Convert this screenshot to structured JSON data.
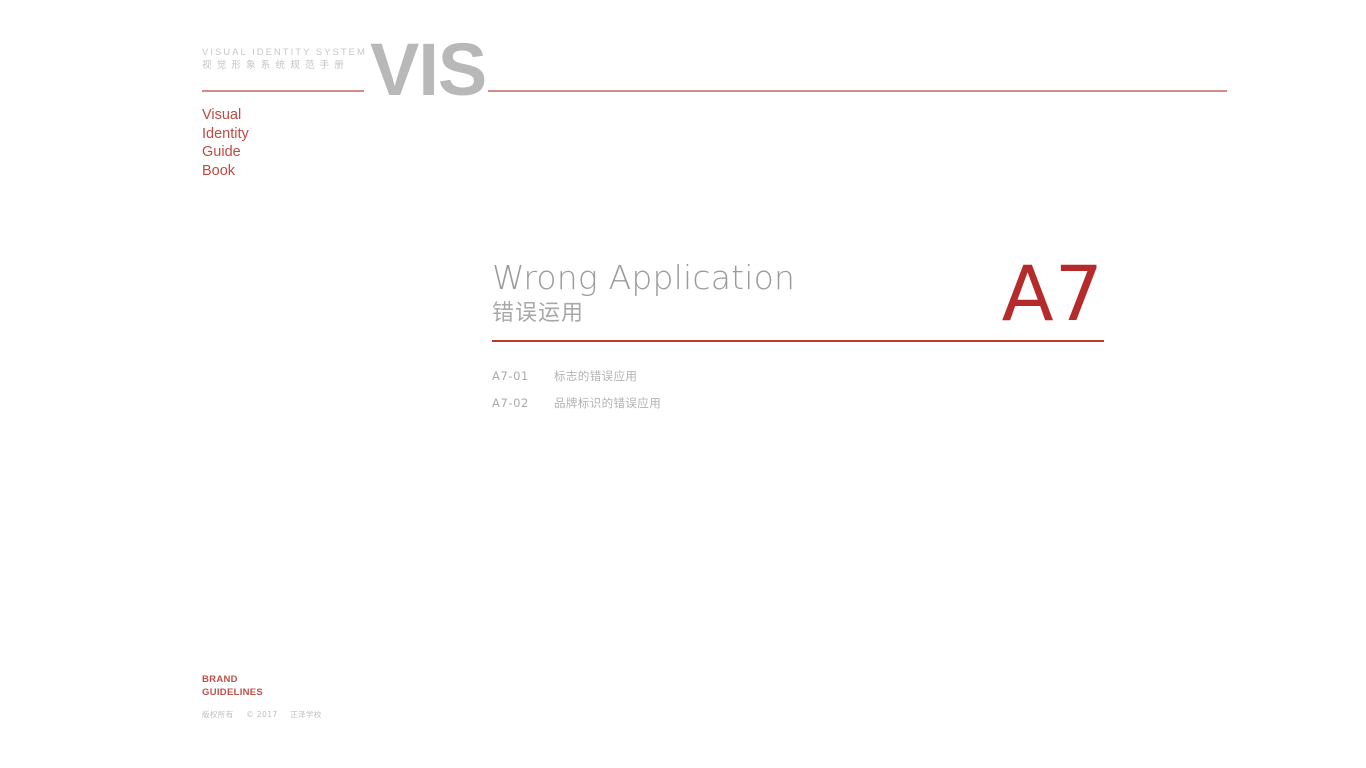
{
  "document": {
    "type": "brand-guidelines-chapter-divider",
    "background_color": "#ffffff"
  },
  "colors": {
    "accent_red": "#b52b2b",
    "rule_red": "#c0392f",
    "rule_red_light": "#d08c86",
    "title_gray": "#9b9b9b",
    "caption_gray": "#c8c8c8",
    "brand_red": "#c0514a"
  },
  "masthead": {
    "caption_en": "VISUAL IDENTITY SYSTEM",
    "caption_cn": "视觉形象系统规范手册",
    "logo": "VIS",
    "subtitle_lines": [
      "Visual",
      "Identity",
      "Guide",
      "Book"
    ]
  },
  "main": {
    "title_en": "Wrong Application",
    "title_cn": "错误运用",
    "chapter_code": "A7"
  },
  "toc": {
    "items": [
      {
        "code": "A7-01",
        "label": "标志的错误应用"
      },
      {
        "code": "A7-02",
        "label": "品牌标识的错误应用"
      }
    ]
  },
  "footer": {
    "brand_line1": "BRAND",
    "brand_line2": "GUIDELINES",
    "copyright_rights": "版权所有",
    "copyright_symbol": "©",
    "copyright_year": "2017",
    "copyright_owner": "正泽学校"
  }
}
